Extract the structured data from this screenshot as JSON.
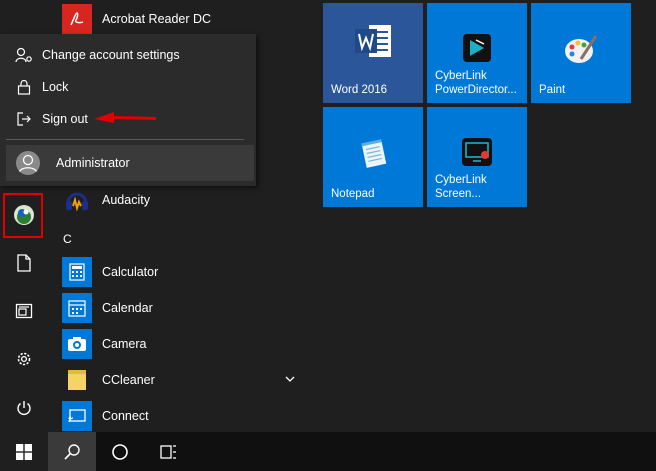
{
  "apps": {
    "acrobat": "Acrobat Reader DC",
    "audacity": "Audacity",
    "section_c": "C",
    "calculator": "Calculator",
    "calendar": "Calendar",
    "camera": "Camera",
    "ccleaner": "CCleaner",
    "connect": "Connect"
  },
  "flyout": {
    "change_account": "Change account settings",
    "lock": "Lock",
    "sign_out": "Sign out",
    "user": "Administrator"
  },
  "tiles": {
    "word": "Word 2016",
    "powerdirector_line1": "CyberLink",
    "powerdirector_line2": "PowerDirector...",
    "paint": "Paint",
    "notepad": "Notepad",
    "screen_line1": "CyberLink",
    "screen_line2": "Screen..."
  },
  "colors": {
    "tile_blue": "#0078d7",
    "word_tile": "#2b579a",
    "annotation_red": "#e00000"
  }
}
